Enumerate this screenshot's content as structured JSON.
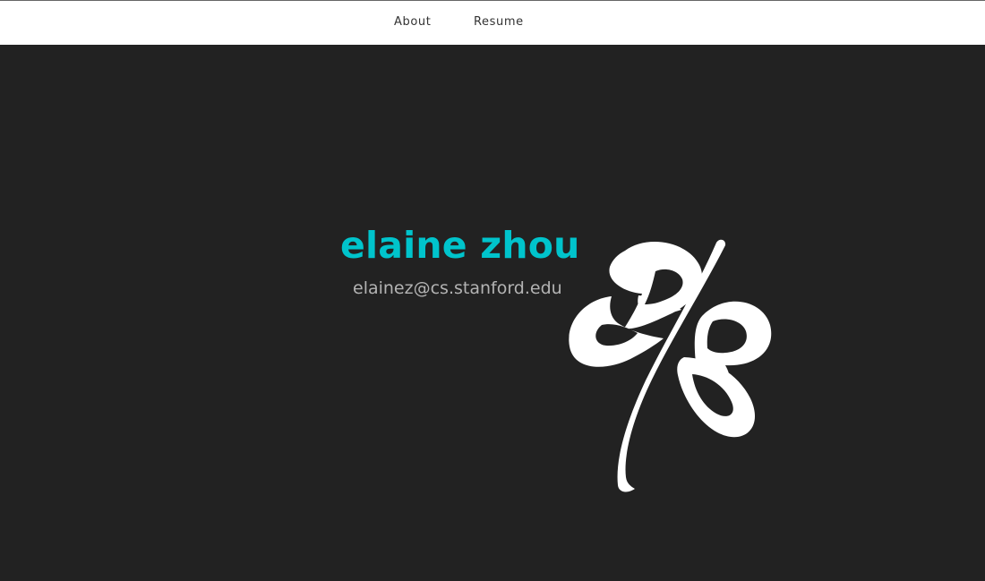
{
  "nav": {
    "items": [
      {
        "label": "About"
      },
      {
        "label": "Resume"
      }
    ]
  },
  "hero": {
    "name": "elaine zhou",
    "email": "elainez@cs.stanford.edu",
    "name_color": "#00c4cc",
    "email_color": "#b3b3b3",
    "background": "#222222"
  },
  "logo": {
    "icon": "flower-monogram-logo-icon",
    "color": "#ffffff"
  }
}
